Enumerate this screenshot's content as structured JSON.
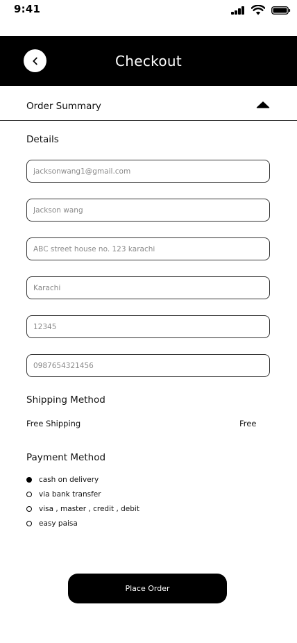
{
  "status_bar": {
    "time": "9:41"
  },
  "header": {
    "title": "Checkout",
    "back_icon": "chevron-left-icon"
  },
  "order_summary": {
    "label": "Order Summary",
    "toggle_icon": "caret-up-icon"
  },
  "details": {
    "title": "Details",
    "fields": [
      {
        "name": "email-field",
        "placeholder": "jacksonwang1@gmail.com",
        "value": ""
      },
      {
        "name": "name-field",
        "placeholder": "Jackson wang",
        "value": ""
      },
      {
        "name": "address-field",
        "placeholder": "ABC street house no. 123 karachi",
        "value": ""
      },
      {
        "name": "city-field",
        "placeholder": "Karachi",
        "value": ""
      },
      {
        "name": "postal-code-field",
        "placeholder": "12345",
        "value": ""
      },
      {
        "name": "phone-field",
        "placeholder": "0987654321456",
        "value": ""
      }
    ]
  },
  "shipping": {
    "title": "Shipping Method",
    "option_name": "Free Shipping",
    "option_price": "Free"
  },
  "payment": {
    "title": "Payment Method",
    "options": [
      {
        "label": "cash on delivery",
        "selected": true
      },
      {
        "label": "via bank transfer",
        "selected": false
      },
      {
        "label": "visa , master , credit , debit",
        "selected": false
      },
      {
        "label": "easy paisa",
        "selected": false
      }
    ]
  },
  "actions": {
    "place_order_label": "Place Order"
  },
  "colors": {
    "header_bg": "#000000",
    "button_bg": "#000000",
    "text": "#111111",
    "border": "#333333"
  }
}
